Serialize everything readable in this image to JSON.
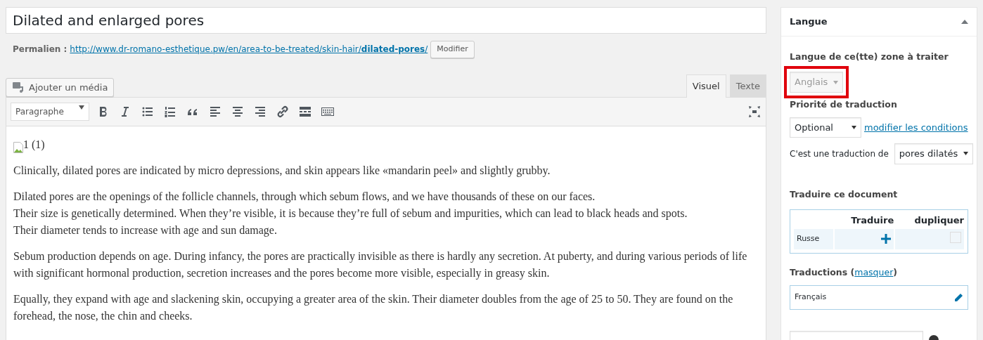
{
  "title": "Dilated and enlarged pores",
  "permalink": {
    "label": "Permalien :",
    "url_start": "http://www.dr-romano-esthetique.pw/en/area-to-be-treated/skin-hair/",
    "url_slug": "dilated-pores",
    "url_end": "/",
    "button": "Modifier"
  },
  "media_button": "Ajouter un média",
  "editor_tabs": [
    {
      "label": "Visuel",
      "selected": true
    },
    {
      "label": "Texte",
      "selected": false
    }
  ],
  "format_select": "Paragraphe",
  "content": {
    "image_alt": "1 (1)",
    "paragraphs": [
      {
        "lines": [
          "Clinically, dilated pores are indicated by micro depressions, and skin appears like «mandarin peel» and slightly grubby."
        ]
      },
      {
        "lines": [
          "Dilated pores are the openings of the follicle channels, through which sebum flows, and we have thousands of these on our faces.",
          "Their size is genetically determined. When they’re visible, it is because they’re full of sebum and impurities, which can lead to black heads and spots.",
          "Their diameter tends to increase with age and sun damage."
        ]
      },
      {
        "lines": [
          "Sebum production depends on age. During infancy, the pores are practically invisible as there is hardly any secretion. At puberty, and during various periods of life with significant hormonal production, secretion increases and the pores become more visible, especially in greasy skin."
        ]
      },
      {
        "lines": [
          "Equally, they expand with age and slackening skin, occupying a greater area of the skin. Their diameter doubles from the age of 25 to 50. They are found on the forehead, the nose, the chin and cheeks."
        ]
      }
    ]
  },
  "sidebar": {
    "title": "Langue",
    "expanded": true,
    "language_label": "Langue de ce(tte) zone à traiter",
    "language_select": {
      "value": "Anglais",
      "disabled": true,
      "highlighted": true
    },
    "priority_label": "Priorité de traduction",
    "priority_select": "Optional",
    "conditions_link": "modifier les conditions",
    "translation_of_label": "C'est une traduction de",
    "translation_of_select": "pores dilatés",
    "translate_heading": "Traduire ce document",
    "translate_table": {
      "columns": [
        "Traduire",
        "dupliquer"
      ],
      "rows": [
        {
          "language": "Russe",
          "duplicate": false
        }
      ]
    },
    "translations_label": "Traductions (",
    "translations_link": "masquer",
    "translations_label_end": ")",
    "translations": [
      "Français"
    ]
  }
}
